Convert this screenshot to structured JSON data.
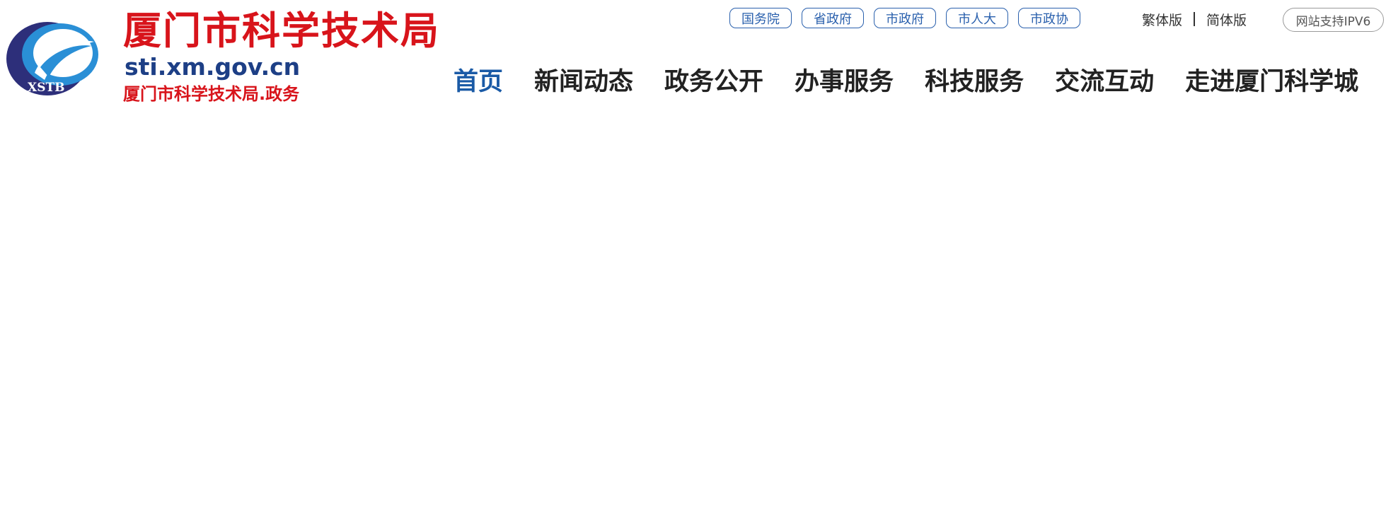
{
  "header": {
    "logo_text": "XSTB",
    "title": "厦门市科学技术局",
    "domain": "sti.xm.gov.cn",
    "subtitle": "厦门市科学技术局.政务",
    "gov_links": [
      "国务院",
      "省政府",
      "市政府",
      "市人大",
      "市政协"
    ],
    "lang": [
      "繁体版",
      "简体版"
    ],
    "ipv6": "网站支持IPV6",
    "nav": [
      "首页",
      "新闻动态",
      "政务公开",
      "办事服务",
      "科技服务",
      "交流互动",
      "走进厦门科学城"
    ]
  },
  "colors": {
    "brand_red": "#d8141b",
    "brand_blue": "#1a5aa6",
    "bar_blue": "#1b59a3",
    "text_dark": "#333333"
  }
}
